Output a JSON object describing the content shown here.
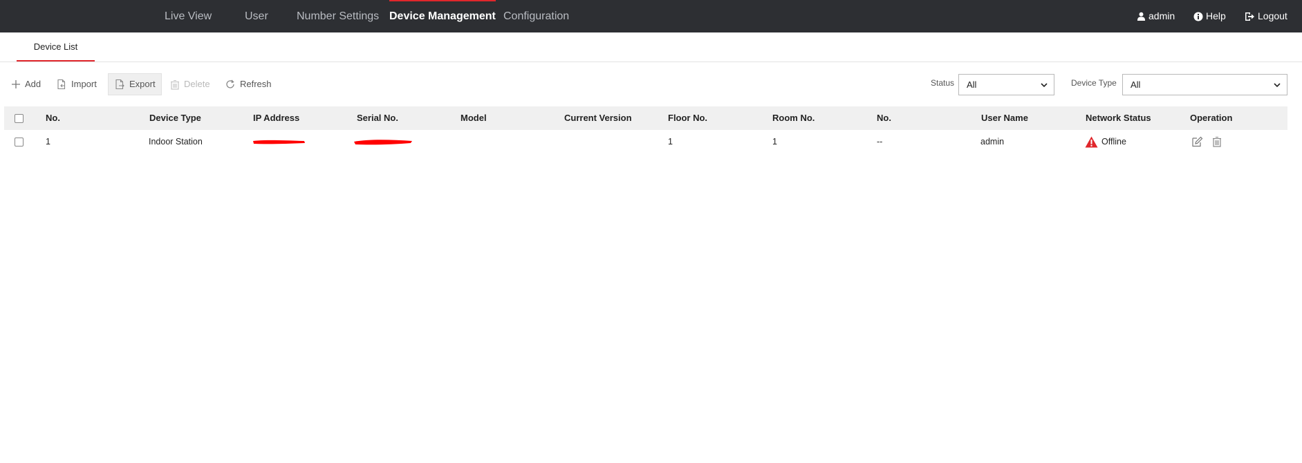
{
  "nav": {
    "items": [
      {
        "label": "Live View"
      },
      {
        "label": "User"
      },
      {
        "label": "Number Settings"
      },
      {
        "label": "Device Management"
      },
      {
        "label": "Configuration"
      }
    ],
    "user_label": "admin",
    "help_label": "Help",
    "logout_label": "Logout"
  },
  "subtabs": {
    "device_list": "Device List"
  },
  "toolbar": {
    "add": "Add",
    "import": "Import",
    "export": "Export",
    "delete": "Delete",
    "refresh": "Refresh"
  },
  "filters": {
    "status_label": "Status",
    "status_value": "All",
    "device_type_label": "Device Type",
    "device_type_value": "All"
  },
  "table": {
    "headers": [
      "No.",
      "Device Type",
      "IP Address",
      "Serial No.",
      "Model",
      "Current Version",
      "Floor No.",
      "Room No.",
      "No.",
      "User Name",
      "Network Status",
      "Operation"
    ],
    "rows": [
      {
        "no": "1",
        "device_type": "Indoor Station",
        "ip_address": "",
        "serial_no": "",
        "model": "",
        "current_version": "",
        "floor_no": "1",
        "room_no": "1",
        "number": "--",
        "user_name": "admin",
        "network_status": "Offline"
      }
    ]
  },
  "colors": {
    "topbar": "#2d2f33",
    "accent": "#e0262b",
    "header_row": "#f0f0f0",
    "warning": "#e0262b",
    "redaction": "#ff0000"
  }
}
